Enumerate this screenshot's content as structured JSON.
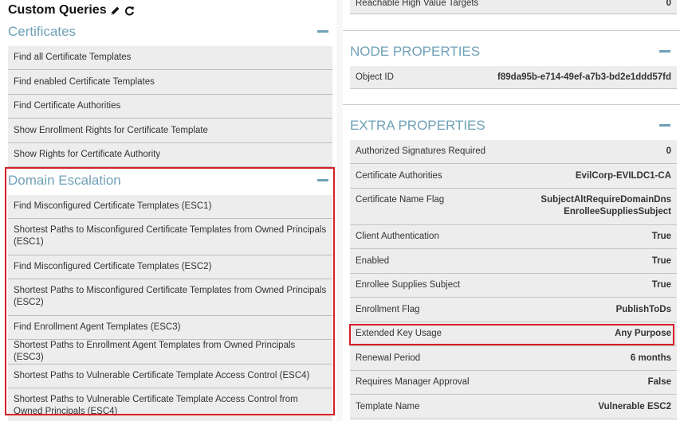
{
  "custom_queries": {
    "title": "Custom Queries",
    "certificates": {
      "heading": "Certificates",
      "items": [
        "Find all Certificate Templates",
        "Find enabled Certificate Templates",
        "Find Certificate Authorities",
        "Show Enrollment Rights for Certificate Template",
        "Show Rights for Certificate Authority"
      ]
    },
    "domain_escalation": {
      "heading": "Domain Escalation",
      "items": [
        "Find Misconfigured Certificate Templates (ESC1)",
        "Shortest Paths to Misconfigured Certificate Templates from Owned Principals (ESC1)",
        "Find Misconfigured Certificate Templates (ESC2)",
        "Shortest Paths to Misconfigured Certificate Templates from Owned Principals (ESC2)",
        "Find Enrollment Agent Templates (ESC3)",
        "Shortest Paths to Enrollment Agent Templates from Owned Principals (ESC3)",
        "Shortest Paths to Vulnerable Certificate Template Access Control (ESC4)",
        "Shortest Paths to Vulnerable Certificate Template Access Control from Owned Principals (ESC4)"
      ]
    }
  },
  "top_row": {
    "name": "Reachable High Value Targets",
    "value": "0"
  },
  "node_properties": {
    "heading": "NODE PROPERTIES",
    "object_id_label": "Object ID",
    "object_id_value": "f89da95b-e714-49ef-a7b3-bd2e1ddd57fd"
  },
  "extra_properties": {
    "heading": "EXTRA PROPERTIES",
    "rows": [
      {
        "name": "Authorized Signatures Required",
        "value": "0"
      },
      {
        "name": "Certificate Authorities",
        "value": "EvilCorp-EVILDC1-CA"
      },
      {
        "name": "Certificate Name Flag",
        "value": "SubjectAltRequireDomainDns",
        "value2": "EnrolleeSuppliesSubject"
      },
      {
        "name": "Client Authentication",
        "value": "True"
      },
      {
        "name": "Enabled",
        "value": "True"
      },
      {
        "name": "Enrollee Supplies Subject",
        "value": "True"
      },
      {
        "name": "Enrollment Flag",
        "value": "PublishToDs"
      },
      {
        "name": "Extended Key Usage",
        "value": "Any Purpose"
      },
      {
        "name": "Renewal Period",
        "value": "6 months"
      },
      {
        "name": "Requires Manager Approval",
        "value": "False"
      },
      {
        "name": "Template Name",
        "value": "Vulnerable ESC2"
      }
    ]
  },
  "colors": {
    "accent": "#6fa1b7",
    "highlight": "#d81f26",
    "row_bg": "#ededed"
  },
  "icons": [
    "pencil-icon",
    "refresh-icon",
    "collapse-icon"
  ]
}
